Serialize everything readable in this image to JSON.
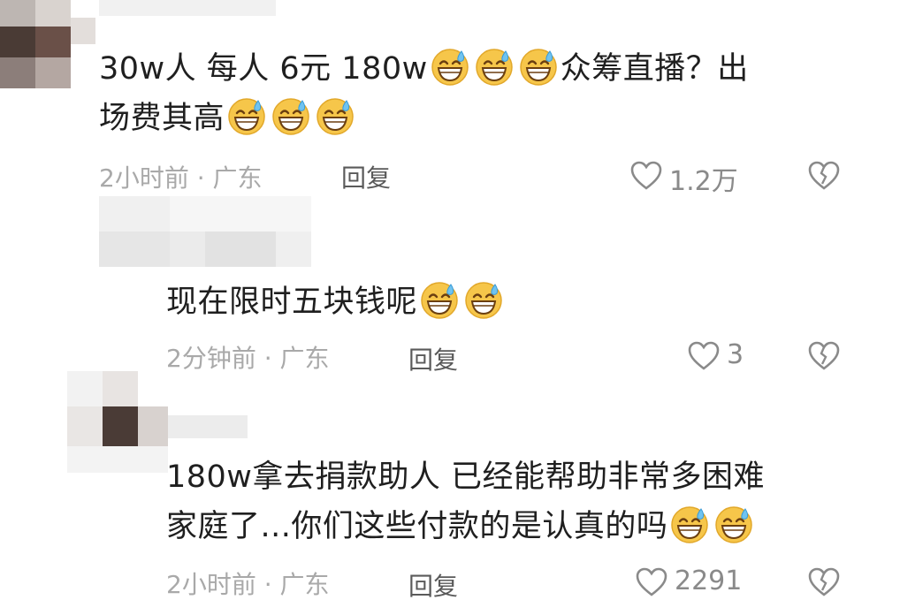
{
  "comments": [
    {
      "line1": "30w人 每人 6元 180w",
      "line1_after": "众筹直播？出",
      "line2": "场费其高",
      "time": "2小时前",
      "location": "· 广东",
      "reply_label": "回复",
      "likes": "1.2万"
    },
    {
      "line1": "现在限时五块钱呢",
      "time": "2分钟前",
      "location": "· 广东",
      "reply_label": "回复",
      "likes": "3"
    },
    {
      "line1": "180w拿去捐款助人 已经能帮助非常多困难",
      "line2": "家庭了...你们这些付款的是认真的吗",
      "time": "2小时前",
      "location": "· 广东",
      "reply_label": "回复",
      "likes": "2291"
    }
  ],
  "icons": {
    "emoji": "grinning-sweat-emoji",
    "like": "heart-outline-icon",
    "dislike": "broken-heart-icon"
  },
  "colors": {
    "text": "#1f1f1f",
    "meta": "#a9a9a9",
    "emoji_face": "#f6c64a",
    "emoji_sweat": "#6fc3f0"
  }
}
